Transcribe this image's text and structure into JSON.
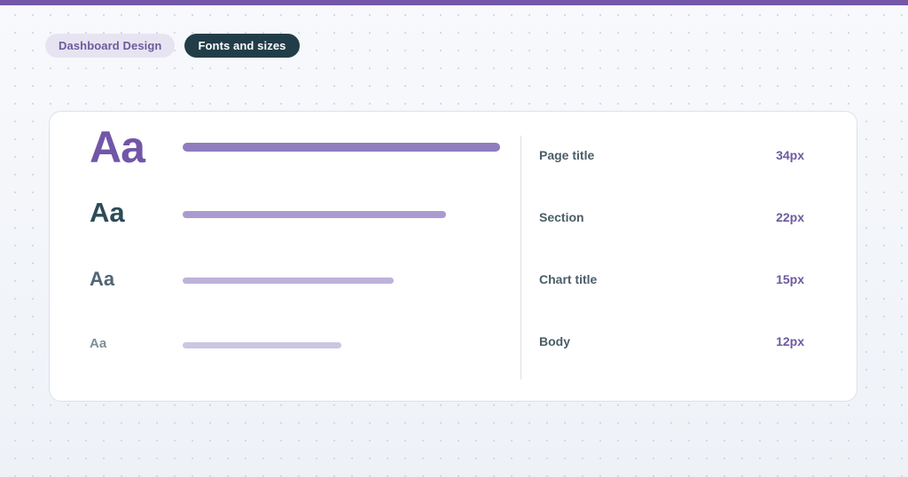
{
  "colors": {
    "accent_bar": "#7257a9",
    "breadcrumb_bg": "#e7e4f1",
    "active_bg": "#213e48",
    "bar_1": "#8f7dbf",
    "bar_2": "#a99bcf",
    "bar_3": "#bdb2da",
    "bar_4": "#cbc6e2"
  },
  "breadcrumbs": [
    {
      "label": "Dashboard Design",
      "active": false
    },
    {
      "label": "Fonts and sizes",
      "active": true
    }
  ],
  "type_scale": {
    "sample_glyph": "Aa",
    "rows": [
      {
        "label": "Page title",
        "size": "34px",
        "bar_fraction": 1.0
      },
      {
        "label": "Section",
        "size": "22px",
        "bar_fraction": 0.83
      },
      {
        "label": "Chart title",
        "size": "15px",
        "bar_fraction": 0.665
      },
      {
        "label": "Body",
        "size": "12px",
        "bar_fraction": 0.5
      }
    ]
  }
}
